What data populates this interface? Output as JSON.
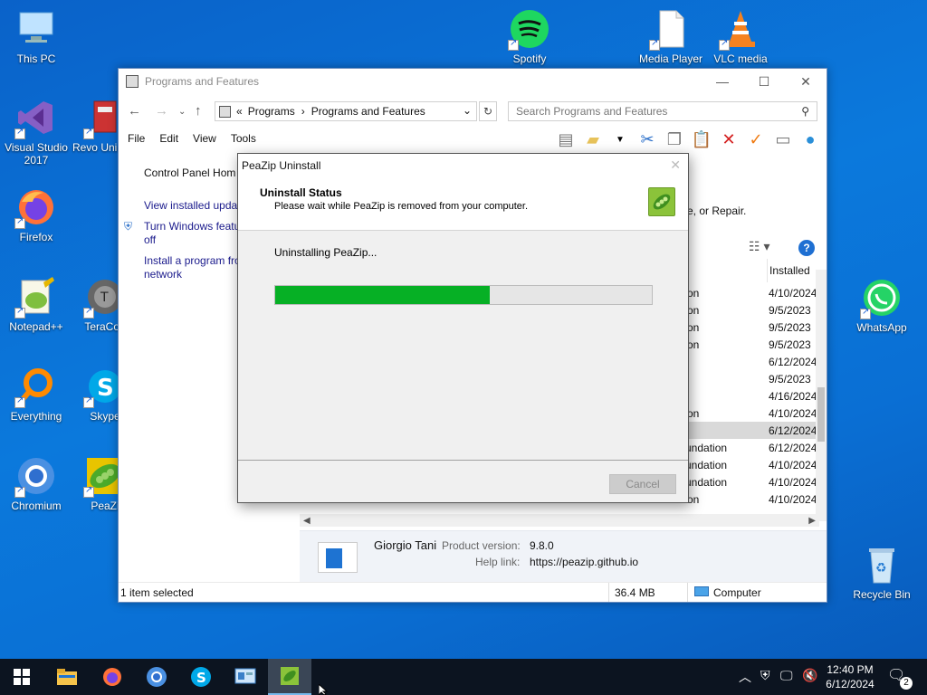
{
  "desktop": {
    "icons": [
      {
        "label": "This PC"
      },
      {
        "label": "Visual Studio 2017"
      },
      {
        "label": "Revo Uninsta"
      },
      {
        "label": "Firefox"
      },
      {
        "label": "Notepad++"
      },
      {
        "label": "TeraCop"
      },
      {
        "label": "Everything"
      },
      {
        "label": "Skype"
      },
      {
        "label": "Chromium"
      },
      {
        "label": "PeaZi"
      },
      {
        "label": "Spotify"
      },
      {
        "label": "Media Player"
      },
      {
        "label": "VLC media"
      },
      {
        "label": "WhatsApp"
      },
      {
        "label": "Recycle Bin"
      }
    ]
  },
  "programs_window": {
    "title": "Programs and Features",
    "breadcrumb": [
      "«",
      "Programs",
      "›",
      "Programs and Features"
    ],
    "search_placeholder": "Search Programs and Features",
    "menu": [
      "File",
      "Edit",
      "View",
      "Tools"
    ],
    "left_pane": {
      "home": "Control Panel Hom",
      "updates": "View installed updat",
      "features": "Turn Windows featu off",
      "network": "Install a program fro network"
    },
    "right_text": "e, or Repair.",
    "column_header": "Installed",
    "rows": [
      {
        "pub": "on",
        "date": "4/10/2024"
      },
      {
        "pub": "on",
        "date": "9/5/2023"
      },
      {
        "pub": "on",
        "date": "9/5/2023"
      },
      {
        "pub": "on",
        "date": "9/5/2023"
      },
      {
        "pub": "",
        "date": "6/12/2024"
      },
      {
        "pub": "",
        "date": "9/5/2023"
      },
      {
        "pub": "",
        "date": "4/16/2024"
      },
      {
        "pub": "on",
        "date": "4/10/2024"
      },
      {
        "pub": "",
        "date": "6/12/2024"
      },
      {
        "pub": "undation",
        "date": "6/12/2024"
      },
      {
        "pub": "undation",
        "date": "4/10/2024"
      },
      {
        "pub": "undation",
        "date": "4/10/2024"
      },
      {
        "pub": "on",
        "date": "4/10/2024"
      }
    ],
    "details": {
      "publisher": "Giorgio Tani",
      "product_version_label": "Product version:",
      "product_version": "9.8.0",
      "help_link_label": "Help link:",
      "help_link": "https://peazip.github.io"
    },
    "status": {
      "selected": "1 item selected",
      "size": "36.4 MB",
      "location": "Computer"
    }
  },
  "dialog": {
    "title": "PeaZip Uninstall",
    "header_title": "Uninstall Status",
    "header_sub": "Please wait while PeaZip is removed from your computer.",
    "status_text": "Uninstalling PeaZip...",
    "progress": 0.57,
    "cancel_label": "Cancel"
  },
  "taskbar": {
    "time": "12:40 PM",
    "date": "6/12/2024",
    "notifications": "2"
  },
  "colors": {
    "progress_green": "#06b025",
    "desktop_blue": "#0b79dc",
    "taskbar": "#0c1420"
  }
}
